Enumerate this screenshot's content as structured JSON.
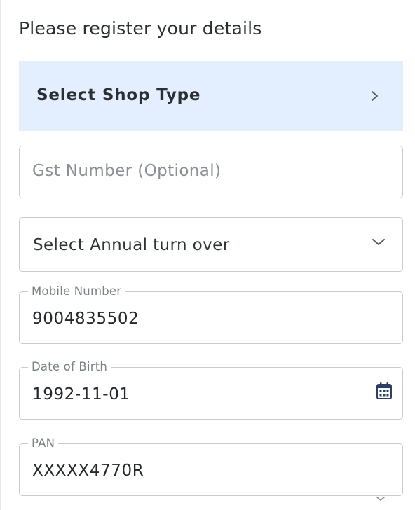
{
  "form": {
    "heading": "Please register your details",
    "shop_type": {
      "label": "Select Shop Type",
      "icon": "chevron-right-icon"
    },
    "gst": {
      "placeholder": "Gst Number (Optional)"
    },
    "annual_turnover": {
      "label": "Select Annual turn over",
      "icon": "chevron-down-icon"
    },
    "mobile": {
      "label": "Mobile Number",
      "value": "9004835502"
    },
    "dob": {
      "label": "Date of Birth",
      "value": "1992-11-01",
      "icon": "calendar-icon"
    },
    "pan": {
      "label": "PAN",
      "value": "XXXXX4770R"
    }
  },
  "colors": {
    "shop_type_bg": "#e3effe",
    "calendar_icon": "#2c3e66",
    "border": "#c8cccf"
  }
}
